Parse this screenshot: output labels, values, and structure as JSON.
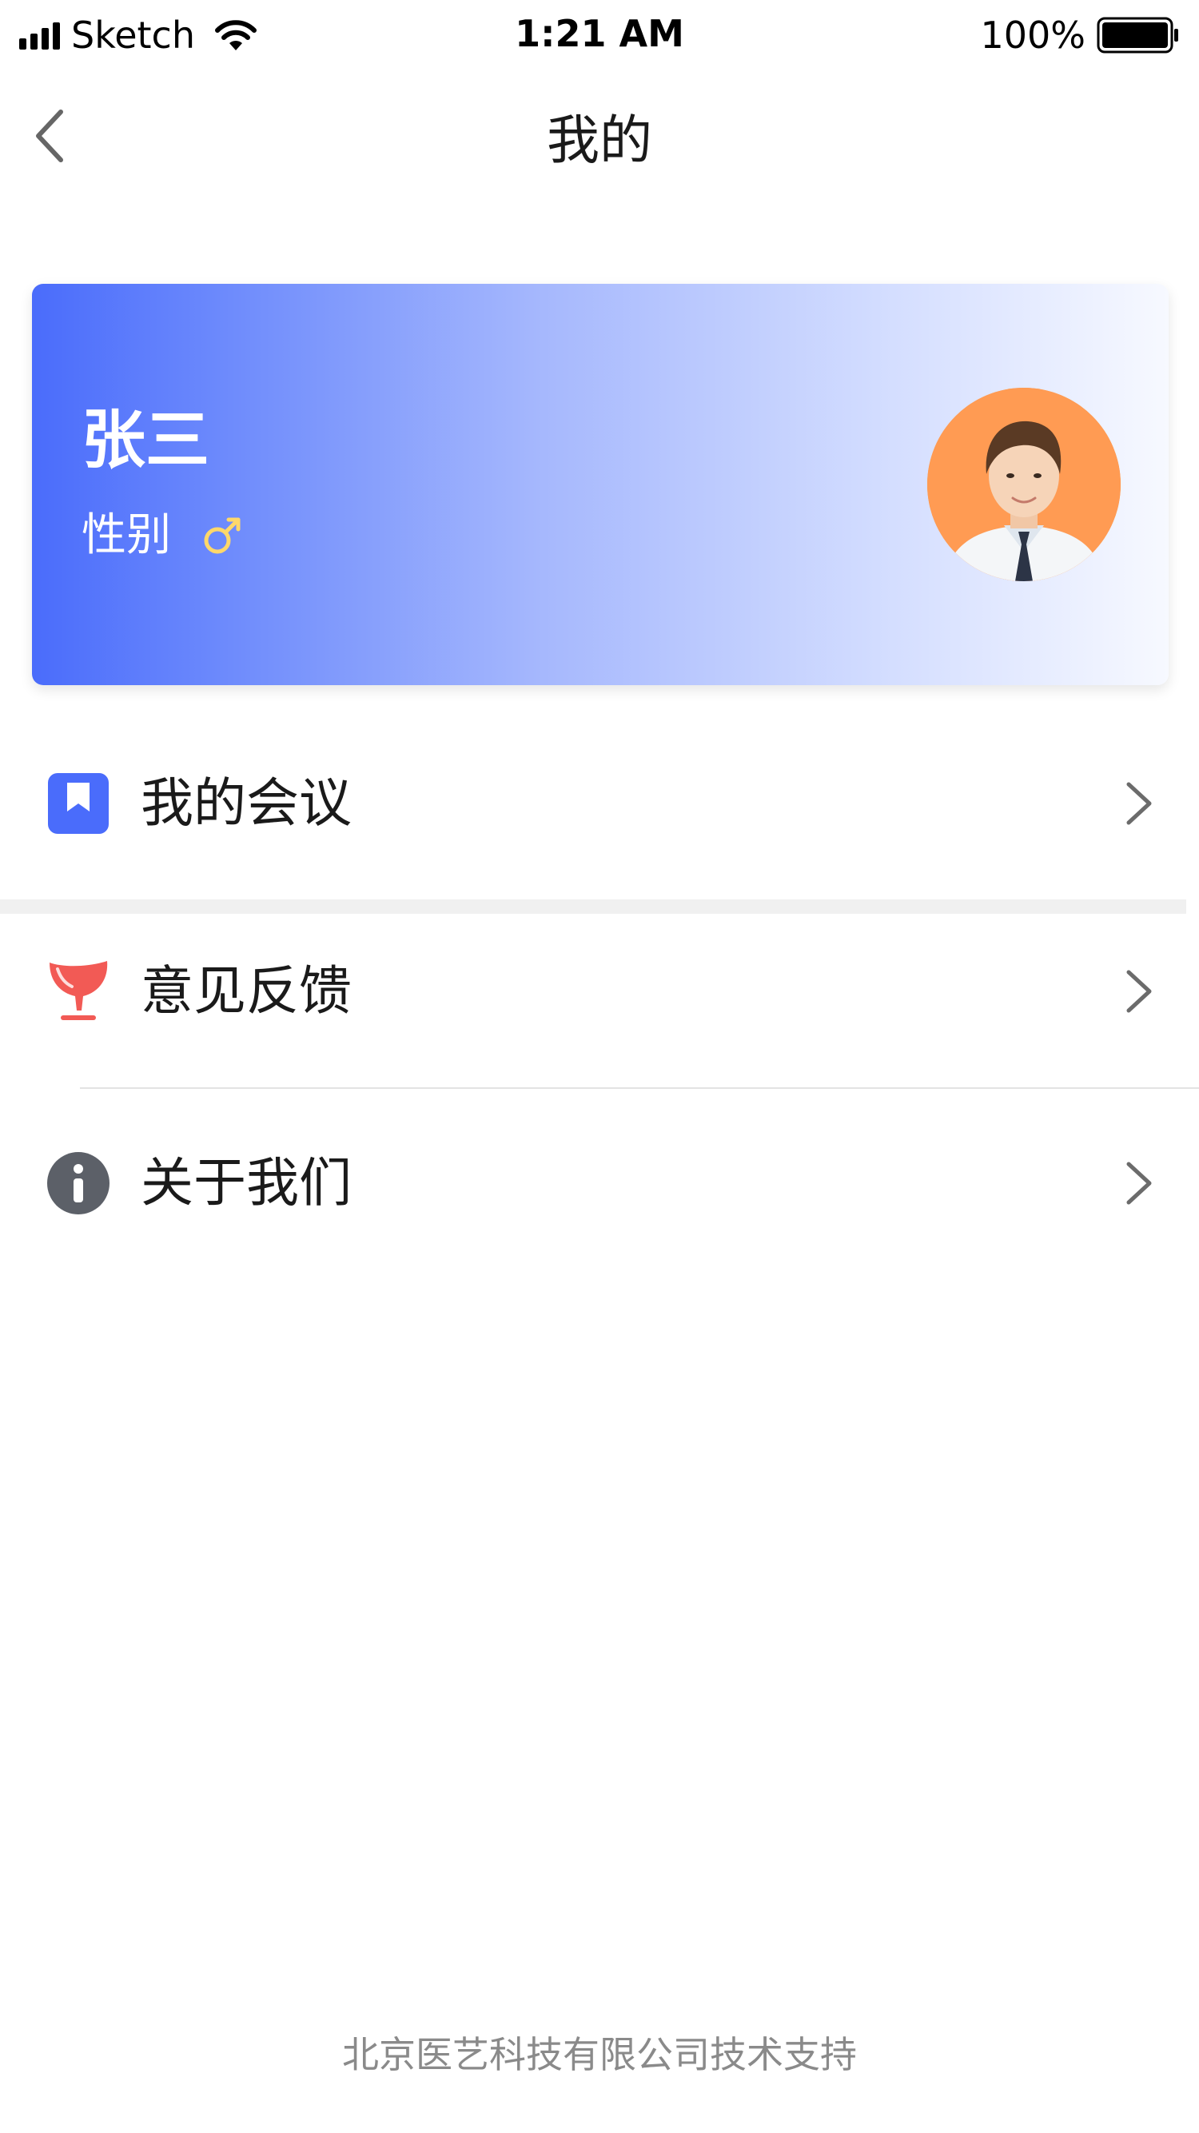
{
  "status_bar": {
    "carrier": "Sketch",
    "time": "1:21 AM",
    "battery": "100%"
  },
  "nav": {
    "title": "我的"
  },
  "profile": {
    "name": "张三",
    "gender_label": "性别",
    "gender_icon": "male-icon",
    "accent_color": "#4a6cfb"
  },
  "menu": [
    {
      "label": "我的会议",
      "icon": "bookmark-icon",
      "color": "#4a6cfb"
    },
    {
      "label": "意见反馈",
      "icon": "feedback-icon",
      "color": "#f25a55"
    },
    {
      "label": "关于我们",
      "icon": "info-icon",
      "color": "#5c6068"
    }
  ],
  "footer": {
    "text": "北京医艺科技有限公司技术支持"
  }
}
